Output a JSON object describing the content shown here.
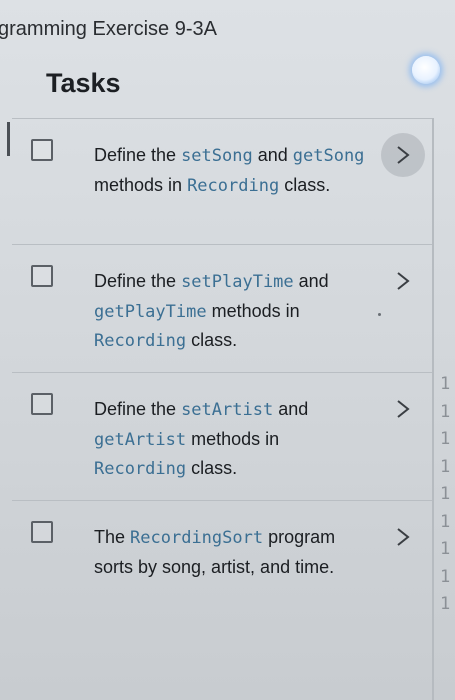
{
  "window": {
    "title": "gramming Exercise 9-3A"
  },
  "panel": {
    "heading": "Tasks"
  },
  "tasks": [
    {
      "segments": [
        {
          "text": "Define the ",
          "code": false
        },
        {
          "text": "setSong",
          "code": true
        },
        {
          "text": " and ",
          "code": false
        },
        {
          "text": "getSong",
          "code": true
        },
        {
          "text": " methods in ",
          "code": false
        },
        {
          "text": "Recording",
          "code": true
        },
        {
          "text": " class.",
          "code": false
        }
      ]
    },
    {
      "segments": [
        {
          "text": "Define the ",
          "code": false
        },
        {
          "text": "setPlayTime",
          "code": true
        },
        {
          "text": " and ",
          "code": false
        },
        {
          "text": "getPlayTime",
          "code": true
        },
        {
          "text": " methods in ",
          "code": false
        },
        {
          "text": "Recording",
          "code": true
        },
        {
          "text": " class.",
          "code": false
        }
      ]
    },
    {
      "segments": [
        {
          "text": "Define the ",
          "code": false
        },
        {
          "text": "setArtist",
          "code": true
        },
        {
          "text": " and ",
          "code": false
        },
        {
          "text": "getArtist",
          "code": true
        },
        {
          "text": " methods in ",
          "code": false
        },
        {
          "text": "Recording",
          "code": true
        },
        {
          "text": " class.",
          "code": false
        }
      ]
    },
    {
      "segments": [
        {
          "text": "The ",
          "code": false
        },
        {
          "text": "RecordingSort",
          "code": true
        },
        {
          "text": " program sorts by song, artist, and time.",
          "code": false
        }
      ]
    }
  ],
  "editor_gutter": [
    "1",
    "1",
    "1",
    "1",
    "1",
    "1",
    "1",
    "1",
    "1"
  ],
  "icons": {
    "checkbox": "checkbox-unchecked-icon",
    "chevron": "chevron-right-icon",
    "toggle": "toggle-knob-icon"
  },
  "colors": {
    "code_text": "#3b6f93",
    "toggle_glow": "#7fb0ea"
  }
}
